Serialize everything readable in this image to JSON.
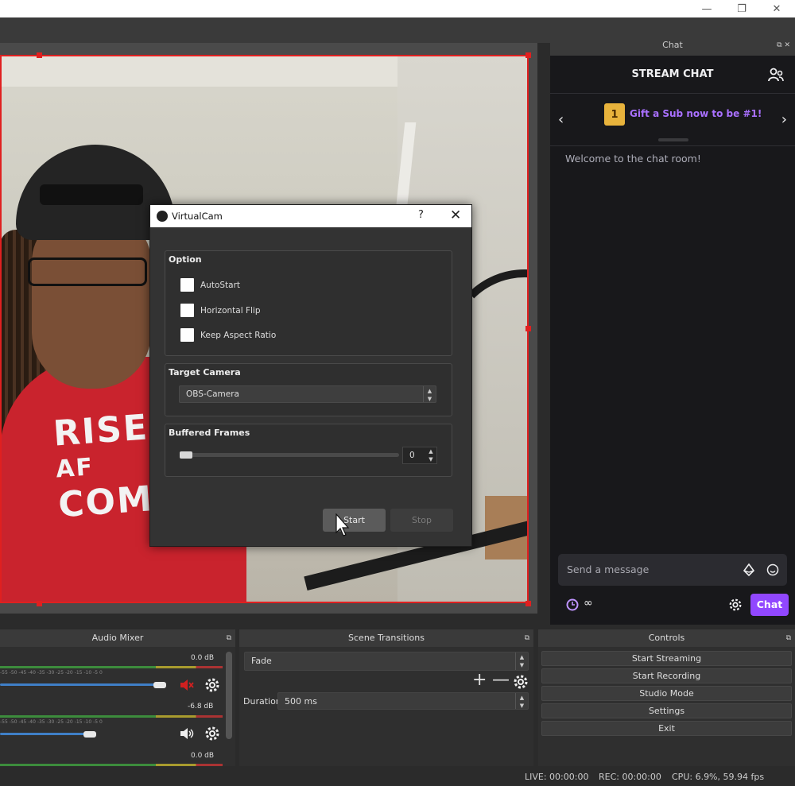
{
  "window": {
    "minimize": "—",
    "restore": "❐",
    "close": "✕"
  },
  "preview": {
    "hoodie_text": [
      "RISE",
      "AF",
      "COMMUNE"
    ]
  },
  "chat": {
    "dock_title": "Chat",
    "header": "STREAM CHAT",
    "gift_badge": "1",
    "gift_text": "Gift a Sub now to be #1!",
    "welcome": "Welcome to the chat room!",
    "input_placeholder": "Send a message",
    "points_value": "∞",
    "send_label": "Chat",
    "accent": "#9147ff"
  },
  "audio_mixer": {
    "title": "Audio Mixer",
    "channels": [
      {
        "db": "0.0 dB",
        "volume": 0.95,
        "muted": true
      },
      {
        "db": "-6.8 dB",
        "volume": 0.55,
        "muted": false
      },
      {
        "db": "0.0 dB"
      }
    ],
    "ticks": "-55  -50  -45  -40  -35  -30  -25  -20  -15  -10  -5  0"
  },
  "scene_transitions": {
    "title": "Scene Transitions",
    "selected": "Fade",
    "add": "+",
    "remove": "—",
    "duration_label": "Duration",
    "duration_value": "500 ms"
  },
  "controls": {
    "title": "Controls",
    "buttons": [
      "Start Streaming",
      "Start Recording",
      "Studio Mode",
      "Settings",
      "Exit"
    ]
  },
  "status": {
    "live": "LIVE: 00:00:00",
    "rec": "REC: 00:00:00",
    "cpu": "CPU: 6.9%, 59.94 fps"
  },
  "dialog": {
    "title": "VirtualCam",
    "help": "?",
    "close": "✕",
    "option_group": "Option",
    "options": [
      "AutoStart",
      "Horizontal Flip",
      "Keep Aspect Ratio"
    ],
    "target_group": "Target Camera",
    "target_value": "OBS-Camera",
    "buffer_group": "Buffered Frames",
    "buffer_value": "0",
    "start_label": "Start",
    "stop_label": "Stop"
  }
}
